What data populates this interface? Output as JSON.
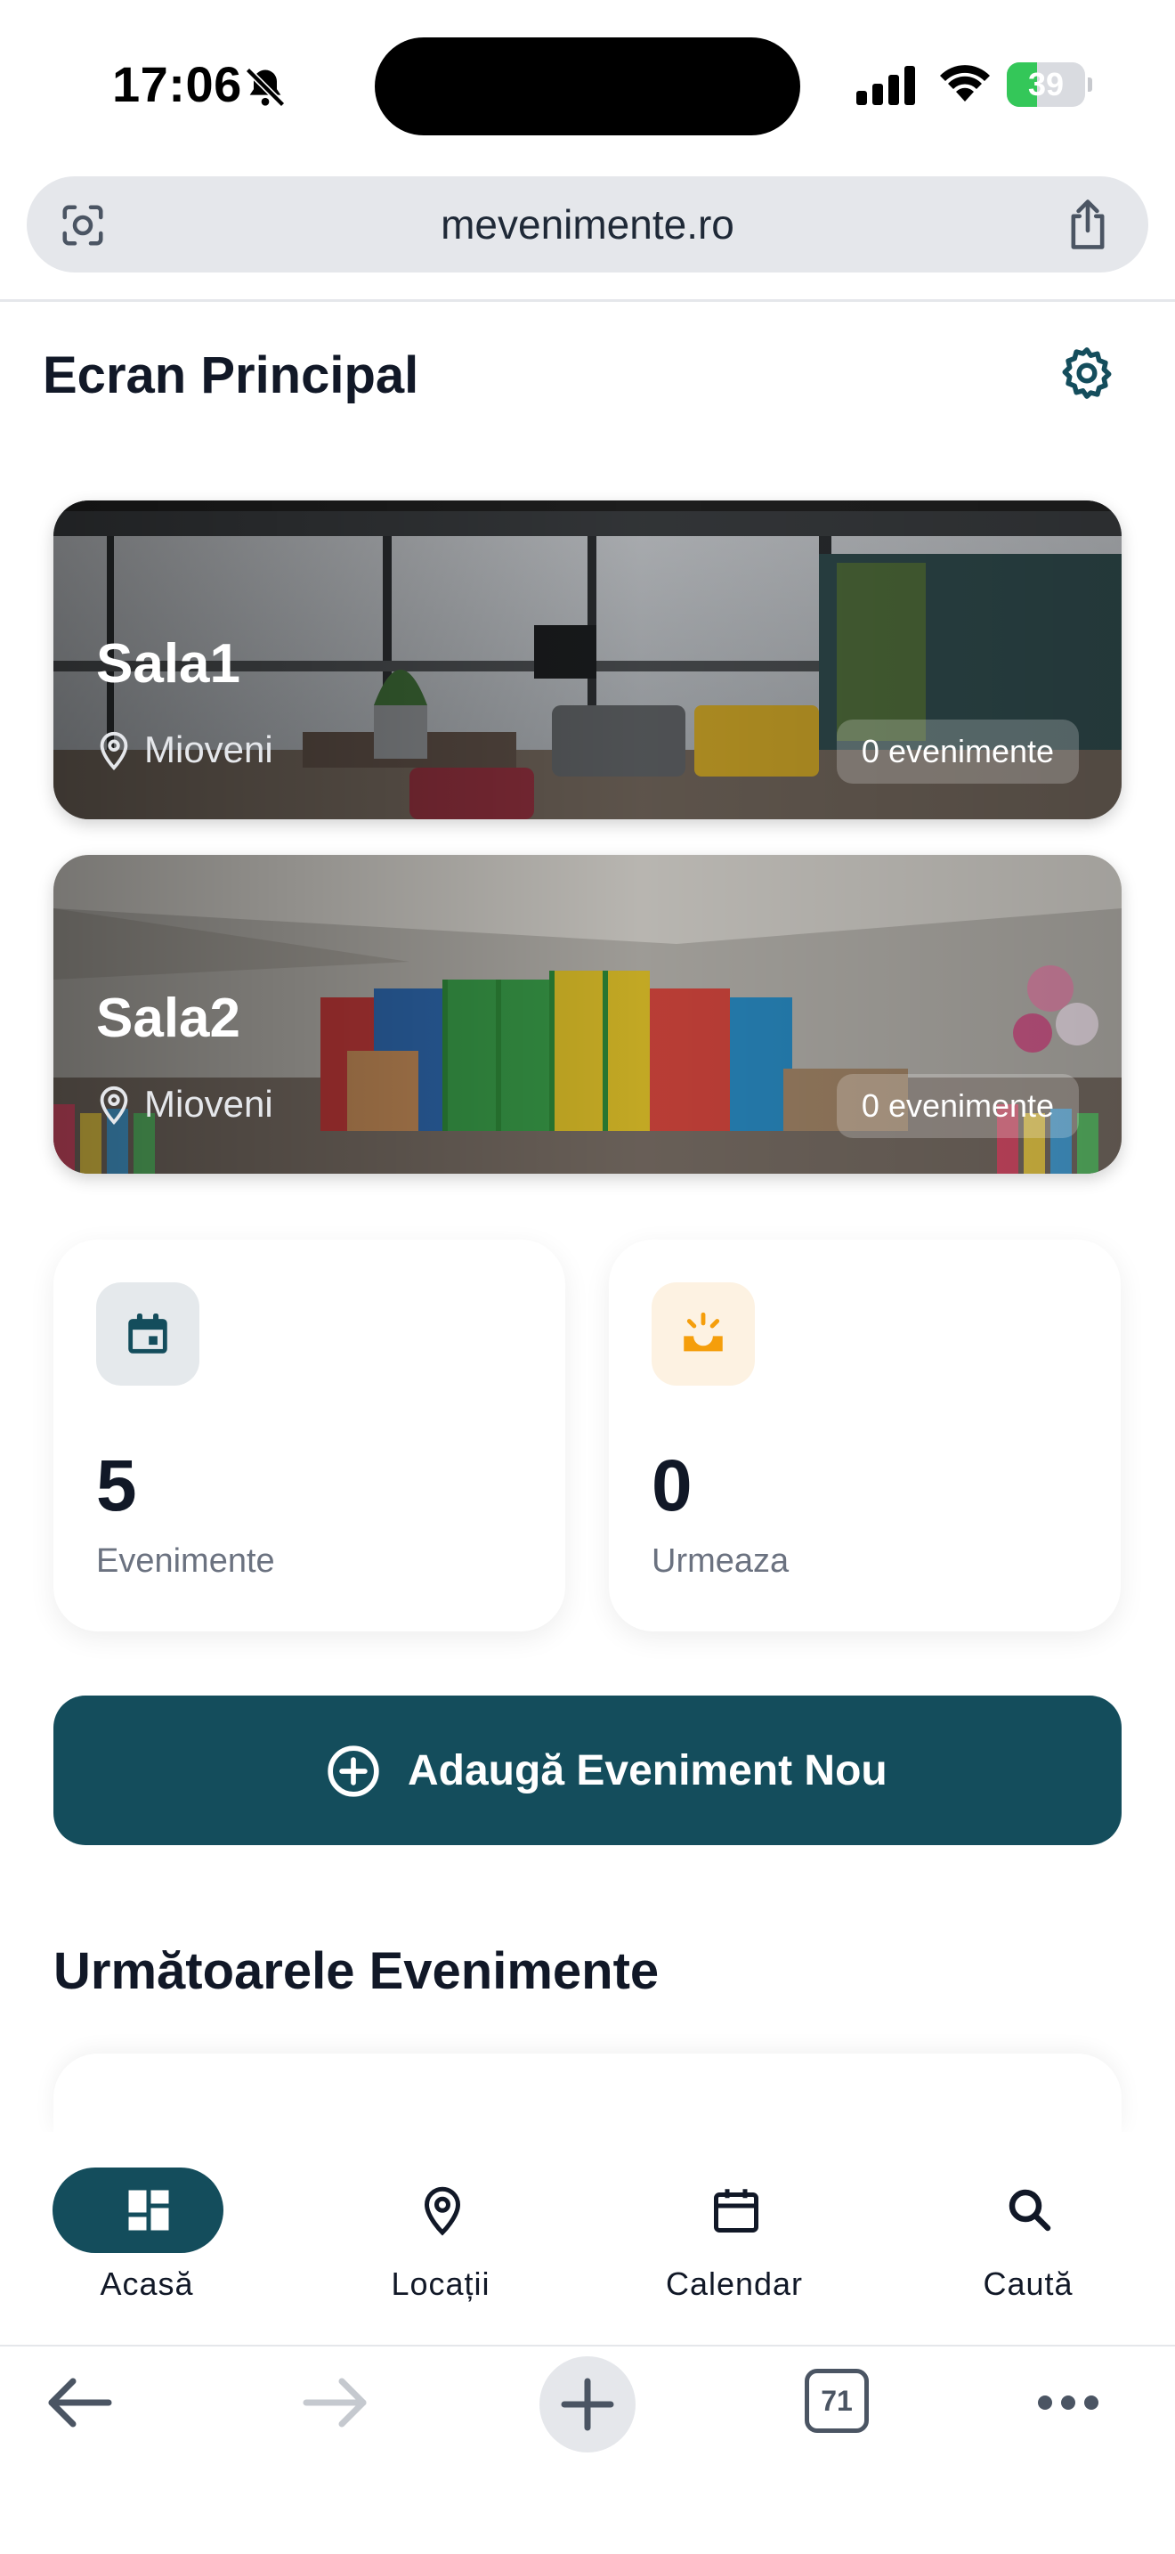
{
  "status": {
    "time": "17:06",
    "battery": "39",
    "battery_level": 0.39
  },
  "browser": {
    "url": "mevenimente.ro",
    "tabs_count": "71"
  },
  "header": {
    "title": "Ecran Principal"
  },
  "venues": [
    {
      "name": "Sala1",
      "location": "Mioveni",
      "events": "0 evenimente"
    },
    {
      "name": "Sala2",
      "location": "Mioveni",
      "events": "0 evenimente"
    }
  ],
  "stats": [
    {
      "value": "5",
      "label": "Evenimente",
      "icon": "calendar-icon",
      "color": "#144d5c",
      "bg": "#e5e9ec"
    },
    {
      "value": "0",
      "label": "Urmeaza",
      "icon": "sunrise-icon",
      "color": "#f59e0b",
      "bg": "#fdf2e2"
    }
  ],
  "actions": {
    "add_event": "Adaugă Eveniment Nou"
  },
  "sections": {
    "upcoming": "Următoarele Evenimente"
  },
  "nav": [
    {
      "label": "Acasă",
      "icon": "dashboard-icon",
      "active": true
    },
    {
      "label": "Locații",
      "icon": "location-pin-icon",
      "active": false
    },
    {
      "label": "Calendar",
      "icon": "calendar-icon",
      "active": false
    },
    {
      "label": "Caută",
      "icon": "search-icon",
      "active": false
    }
  ],
  "colors": {
    "primary": "#144d5c",
    "accent": "#f59e0b"
  }
}
